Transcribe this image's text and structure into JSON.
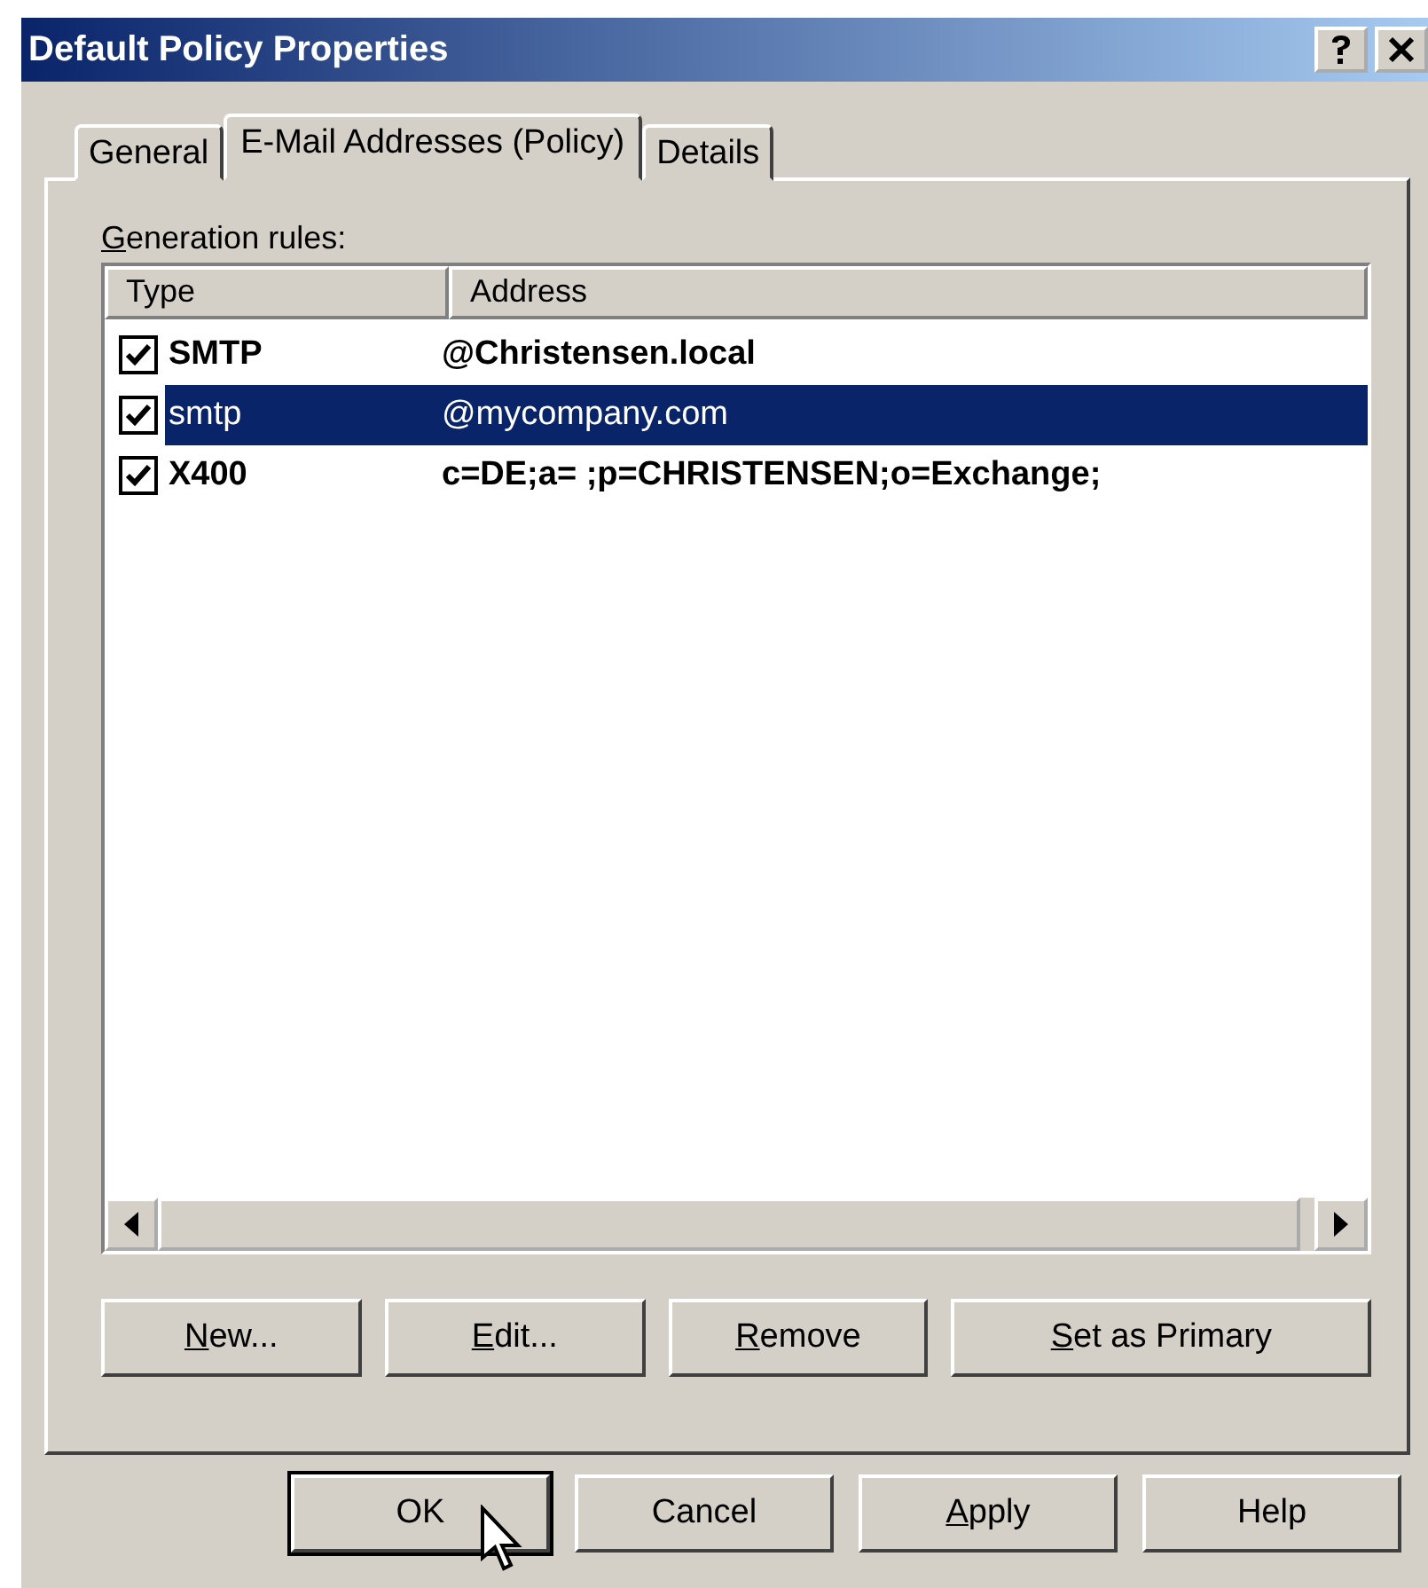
{
  "window": {
    "title": "Default Policy Properties"
  },
  "tabs": [
    {
      "label": "General",
      "selected": false
    },
    {
      "label": "E-Mail Addresses (Policy)",
      "selected": true
    },
    {
      "label": "Details",
      "selected": false
    }
  ],
  "list_label": {
    "key": "G",
    "rest": "eneration rules:"
  },
  "table": {
    "columns": [
      "Type",
      "Address"
    ],
    "rows": [
      {
        "type": "SMTP",
        "address": "@Christensen.local",
        "checked": true,
        "selected": false,
        "primary": true
      },
      {
        "type": "smtp",
        "address": "@mycompany.com",
        "checked": true,
        "selected": true,
        "primary": false
      },
      {
        "type": "X400",
        "address": "c=DE;a= ;p=CHRISTENSEN;o=Exchange;",
        "checked": true,
        "selected": false,
        "primary": true
      }
    ]
  },
  "list_buttons": [
    {
      "key": "N",
      "rest": "ew..."
    },
    {
      "key": "E",
      "rest": "dit..."
    },
    {
      "key": "R",
      "rest": "emove"
    },
    {
      "key": "S",
      "rest": "et as Primary"
    }
  ],
  "dialog_buttons": [
    {
      "label": "OK",
      "default": true
    },
    {
      "label": "Cancel",
      "default": false
    },
    {
      "key": "A",
      "rest": "pply",
      "default": false
    },
    {
      "label": "Help",
      "default": false
    }
  ]
}
